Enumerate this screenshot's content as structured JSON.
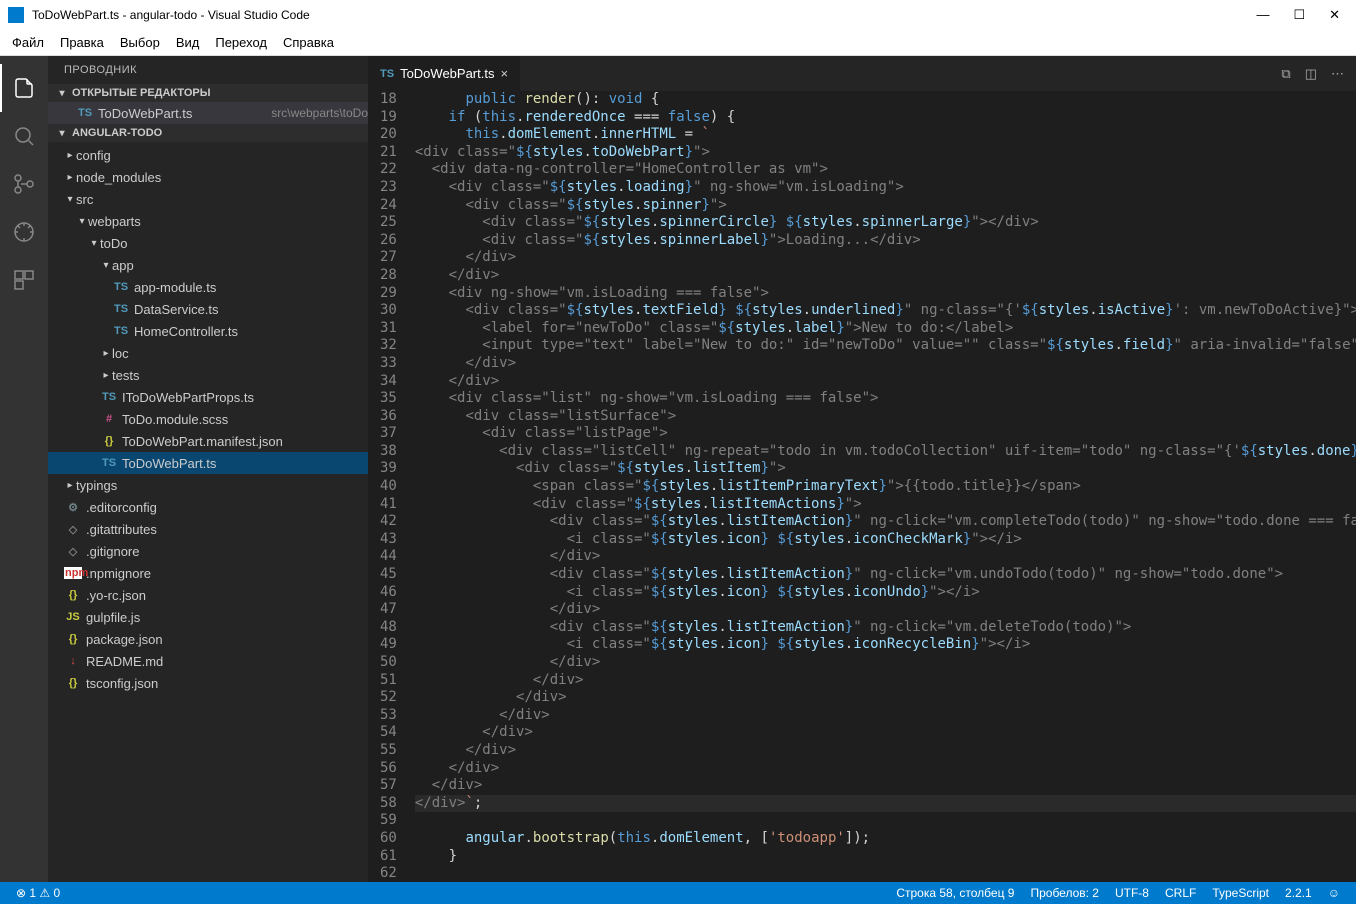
{
  "window": {
    "title": "ToDoWebPart.ts - angular-todo - Visual Studio Code"
  },
  "menu": [
    "Файл",
    "Правка",
    "Выбор",
    "Вид",
    "Переход",
    "Справка"
  ],
  "sidebar": {
    "title": "ПРОВОДНИК",
    "openEditors": {
      "label": "ОТКРЫТЫЕ РЕДАКТОРЫ",
      "file": "ToDoWebPart.ts",
      "path": "src\\webparts\\toDo"
    },
    "project": "ANGULAR-TODO",
    "tree": {
      "config": "config",
      "node_modules": "node_modules",
      "src": "src",
      "webparts": "webparts",
      "toDo": "toDo",
      "app": "app",
      "appmodule": "app-module.ts",
      "dataservice": "DataService.ts",
      "homecontroller": "HomeController.ts",
      "loc": "loc",
      "tests": "tests",
      "itodoprops": "IToDoWebPartProps.ts",
      "todomodule": "ToDo.module.scss",
      "manifest": "ToDoWebPart.manifest.json",
      "todowp": "ToDoWebPart.ts",
      "typings": "typings",
      "editorconfig": ".editorconfig",
      "gitattributes": ".gitattributes",
      "gitignore": ".gitignore",
      "npmignore": ".npmignore",
      "yorc": ".yo-rc.json",
      "gulpfile": "gulpfile.js",
      "package": "package.json",
      "readme": "README.md",
      "tsconfig": "tsconfig.json"
    }
  },
  "tab": {
    "label": "ToDoWebPart.ts"
  },
  "lines": [
    18,
    19,
    20,
    21,
    22,
    23,
    24,
    25,
    26,
    27,
    28,
    29,
    30,
    31,
    32,
    33,
    34,
    35,
    36,
    37,
    38,
    39,
    40,
    41,
    42,
    43,
    44,
    45,
    46,
    47,
    48,
    49,
    50,
    51,
    52,
    53,
    54,
    55,
    56,
    57,
    58,
    59,
    60,
    61,
    62
  ],
  "status": {
    "errors": "1",
    "warnings": "0",
    "line": "Строка 58, столбец 9",
    "spaces": "Пробелов: 2",
    "encoding": "UTF-8",
    "eol": "CRLF",
    "lang": "TypeScript",
    "version": "2.2.1"
  }
}
